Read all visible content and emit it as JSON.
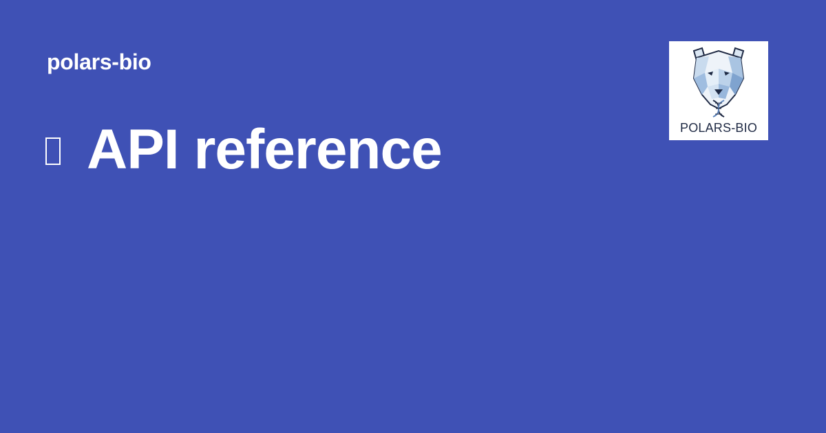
{
  "site": {
    "name": "polars-bio"
  },
  "page": {
    "title_icon": "book-icon",
    "title": "API reference"
  },
  "logo": {
    "name": "polar-bear-dna-logo",
    "text": "POLARS-BIO"
  },
  "colors": {
    "background": "#3f51b5",
    "text": "#ffffff",
    "logo_background": "#ffffff",
    "logo_ink": "#1f2a44",
    "logo_blue": "#8fb2d6"
  }
}
